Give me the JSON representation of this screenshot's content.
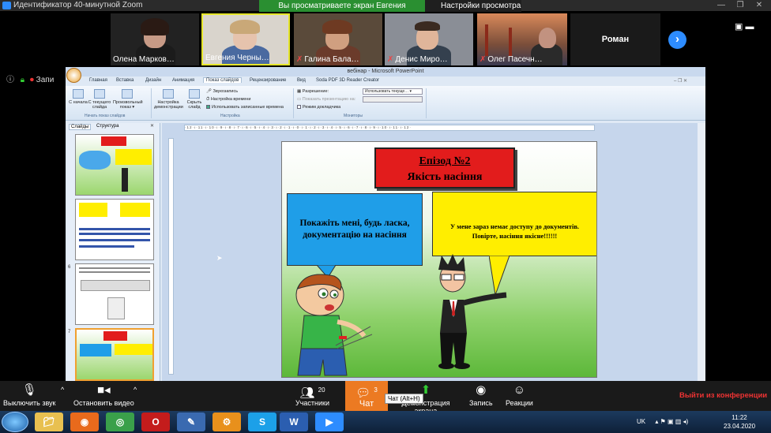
{
  "zoom": {
    "window_title": "Идентификатор 40-минутной Zoom",
    "viewing_banner": "Вы просматриваете экран Евгения Чернышова",
    "view_options": "Настройки просмотра",
    "participants": [
      {
        "name": "Олена Марков…",
        "muted": false
      },
      {
        "name": "Евгения Черны…",
        "muted": false
      },
      {
        "name": "Галина Бала…",
        "muted": true
      },
      {
        "name": "Денис Миро…",
        "muted": true
      },
      {
        "name": "Олег Пасечн…",
        "muted": true
      },
      {
        "name": "Роман",
        "muted": false
      }
    ],
    "recording_label": "Запи",
    "controls": {
      "mute": "Выключить звук",
      "video": "Остановить видео",
      "participants": "Участники",
      "participants_count": "20",
      "chat": "Чат",
      "chat_count": "3",
      "chat_tooltip": "Чат (Alt+H)",
      "share": "Демонстрация экрана",
      "record": "Запись",
      "reactions": "Реакции",
      "leave": "Выйти из конференции"
    }
  },
  "powerpoint": {
    "title": "вебінар - Microsoft PowerPoint",
    "tabs": [
      "Главная",
      "Вставка",
      "Дизайн",
      "Анимация",
      "Показ слайдов",
      "Рецензирование",
      "Вид",
      "Soda PDF 3D Reader Creator"
    ],
    "active_tab": "Показ слайдов",
    "ribbon": {
      "from_start": "С начала",
      "from_current": "С текущего слайда",
      "custom_show": "Произвольный показ",
      "group_start": "Начать показ слайдов",
      "setup_show": "Настройка демонстрации",
      "hide_slide": "Скрыть слайд",
      "record_narration": "Звукозапись",
      "rehearse": "Настройка времени",
      "use_timings": "Использовать записанные времена",
      "group_setup": "Настройка",
      "resolution_label": "Разрешение:",
      "resolution_value": "Использовать текуще…",
      "show_on_label": "Показать презентацию на:",
      "presenter_view": "Режим докладчика",
      "group_monitors": "Мониторы"
    },
    "pane_tabs": [
      "Слайды",
      "Структура"
    ],
    "slide_numbers": [
      "",
      "",
      "6",
      "7"
    ],
    "ruler_text": "·12·ı·11·ı·10·ı·9·ı·8·ı·7·ı·6·ı·5·ı·4·ı·3·ı·2·ı·1·ı·0·ı·1·ı·2·ı·3·ı·4·ı·5·ı·6·ı·7·ı·8·ı·9·ı·10·ı·11·ı·12·",
    "slide": {
      "title_line1": "Епізод №2",
      "title_line2": "Якість насіння",
      "bubble_left": "Покажіть мені, будь ласка, документацію на насіння",
      "bubble_right_line1": "У мене зараз немає доступу до документів.",
      "bubble_right_line2": "Повірте, насіння якісне!!!!!!"
    }
  },
  "taskbar": {
    "language": "UK",
    "time": "11:22",
    "date": "23.04.2020"
  }
}
